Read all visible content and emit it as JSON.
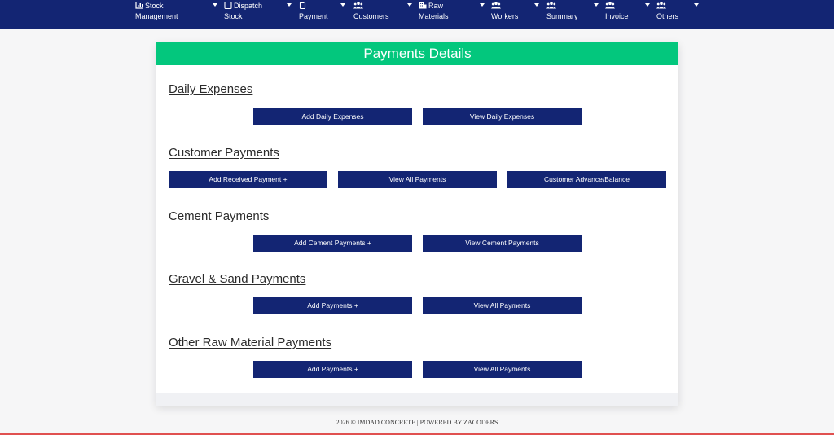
{
  "nav": {
    "items": [
      {
        "line1": "Stock",
        "line2": "Management",
        "icon": "chart-icon"
      },
      {
        "line1": "Dispatch",
        "line2": "Stock",
        "icon": "checkbox-icon"
      },
      {
        "line1": "",
        "line2": "Payment",
        "icon": "clipboard-icon"
      },
      {
        "line1": "",
        "line2": "Customers",
        "icon": "users-icon"
      },
      {
        "line1": "Raw",
        "line2": "Materials",
        "icon": "building-icon"
      },
      {
        "line1": "",
        "line2": "Workers",
        "icon": "users-icon"
      },
      {
        "line1": "",
        "line2": "Summary",
        "icon": "users-icon"
      },
      {
        "line1": "",
        "line2": "Invoice",
        "icon": "users-icon"
      },
      {
        "line1": "",
        "line2": "Others",
        "icon": "users-icon"
      }
    ]
  },
  "card": {
    "title": "Payments Details",
    "sections": [
      {
        "title": "Daily Expenses",
        "buttons": [
          "Add Daily Expenses",
          "View Daily Expenses"
        ]
      },
      {
        "title": "Customer Payments",
        "buttons": [
          "Add Received Payment +",
          "View All Payments",
          "Customer Advance/Balance"
        ]
      },
      {
        "title": "Cement Payments",
        "buttons": [
          "Add Cement Payments +",
          "View Cement Payments"
        ]
      },
      {
        "title": "Gravel & Sand Payments",
        "buttons": [
          "Add Payments +",
          "View All Payments"
        ]
      },
      {
        "title": "Other Raw Material Payments",
        "buttons": [
          "Add Payments +",
          "View All Payments"
        ]
      }
    ]
  },
  "footer": {
    "text": "2026 © IMDAD CONCRETE | POWERED BY ZACODERS"
  },
  "colors": {
    "navbar": "#132573",
    "header": "#03c77d",
    "button": "#132573"
  }
}
